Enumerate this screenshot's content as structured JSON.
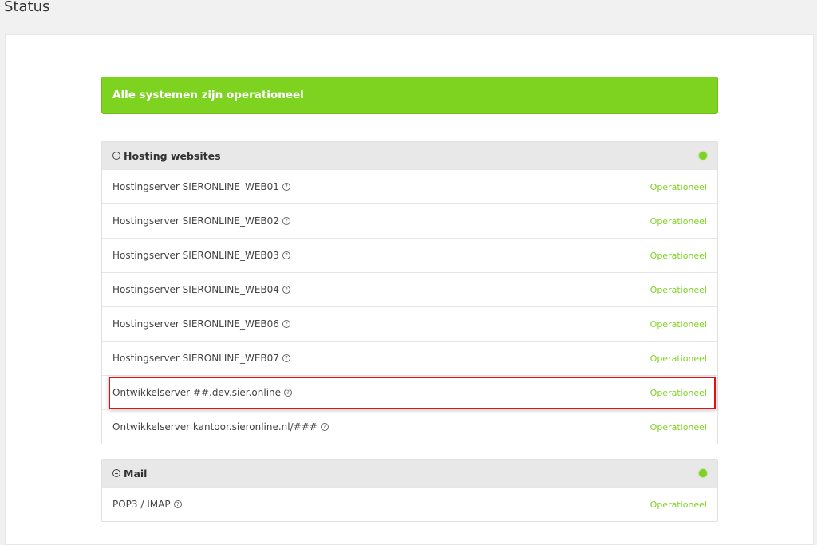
{
  "page_title": "Status",
  "banner": "Alle systemen zijn operationeel",
  "status_color": "#7ed321",
  "sections": [
    {
      "title": "Hosting websites",
      "rows": [
        {
          "name": "Hostingserver SIERONLINE_WEB01",
          "status": "Operationeel"
        },
        {
          "name": "Hostingserver SIERONLINE_WEB02",
          "status": "Operationeel"
        },
        {
          "name": "Hostingserver SIERONLINE_WEB03",
          "status": "Operationeel"
        },
        {
          "name": "Hostingserver SIERONLINE_WEB04",
          "status": "Operationeel"
        },
        {
          "name": "Hostingserver SIERONLINE_WEB06",
          "status": "Operationeel"
        },
        {
          "name": "Hostingserver SIERONLINE_WEB07",
          "status": "Operationeel"
        },
        {
          "name": "Ontwikkelserver ##.dev.sier.online",
          "status": "Operationeel",
          "highlighted": true
        },
        {
          "name": "Ontwikkelserver kantoor.sieronline.nl/###",
          "status": "Operationeel"
        }
      ]
    },
    {
      "title": "Mail",
      "rows": [
        {
          "name": "POP3 / IMAP",
          "status": "Operationeel"
        }
      ]
    }
  ]
}
